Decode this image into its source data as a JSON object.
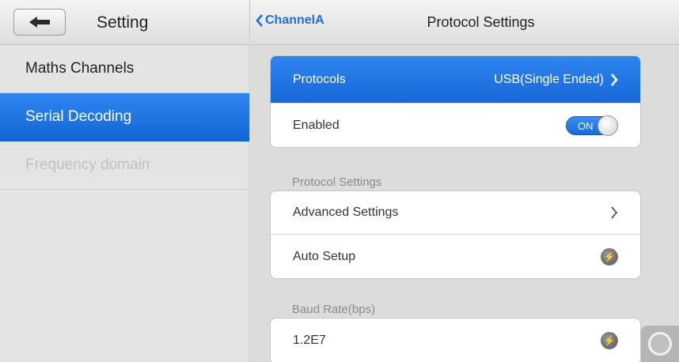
{
  "left": {
    "title": "Setting",
    "back_icon": "back-arrow-icon",
    "items": [
      {
        "label": "Maths Channels"
      },
      {
        "label": "Serial Decoding"
      },
      {
        "label": "Frequency domain"
      }
    ]
  },
  "right": {
    "breadcrumb": "ChannelA",
    "title": "Protocol Settings",
    "protocols": {
      "label": "Protocols",
      "value": "USB(Single Ended)"
    },
    "enabled": {
      "label": "Enabled",
      "toggle": "ON"
    },
    "section_protocol": "Protocol Settings",
    "advanced": {
      "label": "Advanced Settings"
    },
    "auto_setup": {
      "label": "Auto Setup"
    },
    "section_baud": "Baud Rate(bps)",
    "baud": {
      "value": "1.2E7"
    }
  },
  "colors": {
    "accent": "#1d6ee0",
    "active_bg": "#1a6ad8"
  }
}
